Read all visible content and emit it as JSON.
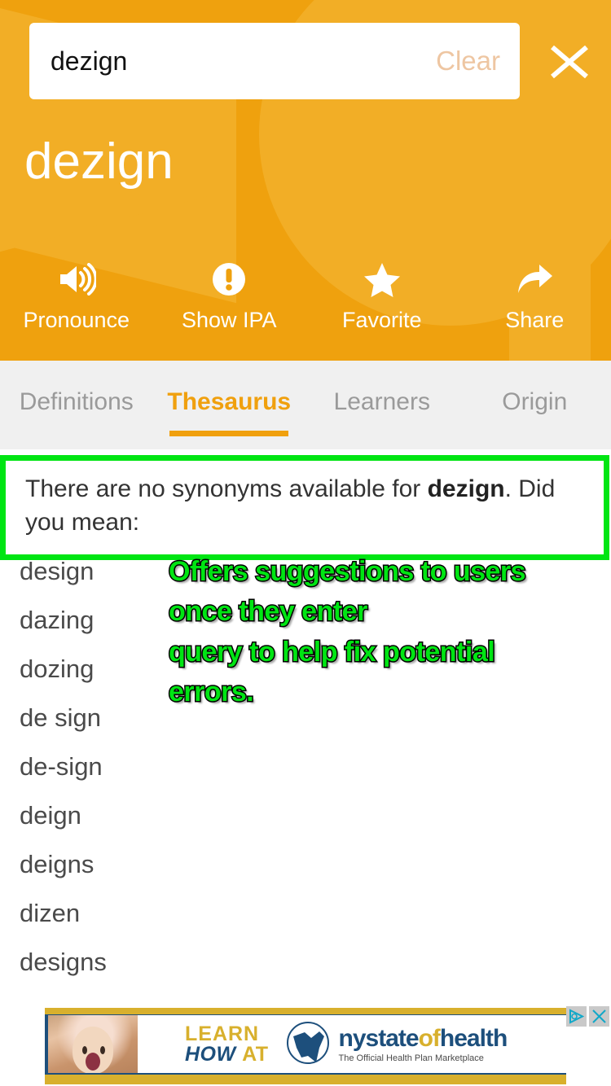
{
  "colors": {
    "header_orange": "#efa10e",
    "watermark_orange": "#f2ae26",
    "accent_orange": "#f0a00e",
    "annotation_green": "#00e513",
    "tab_bar_bg": "#f0f0f0",
    "clear_text": "#eec6a2",
    "ad_gold": "#d8b02d",
    "ad_blue": "#1d4f7c"
  },
  "search": {
    "value": "dezign",
    "placeholder": "Search the dictionary",
    "clear_label": "Clear",
    "close_icon": "close-x-icon"
  },
  "header": {
    "word": "dezign",
    "actions": [
      {
        "label": "Pronounce",
        "icon": "speaker-icon"
      },
      {
        "label": "Show IPA",
        "icon": "exclamation-circle-icon"
      },
      {
        "label": "Favorite",
        "icon": "star-icon"
      },
      {
        "label": "Share",
        "icon": "share-arrow-icon"
      }
    ]
  },
  "tabs": [
    {
      "label": "Definitions",
      "active": false
    },
    {
      "label": "Thesaurus",
      "active": true
    },
    {
      "label": "Learners",
      "active": false
    },
    {
      "label": "Origin",
      "active": false
    }
  ],
  "message": {
    "prefix": "There are no synonyms available for ",
    "word": "dezign",
    "suffix": ". Did you mean:"
  },
  "suggestions": [
    "design",
    "dazing",
    "dozing",
    "de sign",
    "de-sign",
    "deign",
    "deigns",
    "dizen",
    "designs"
  ],
  "annotation": {
    "lines": [
      "Offers suggestions to users",
      "once they enter",
      "query to help fix potential",
      "errors."
    ]
  },
  "ad": {
    "line1": "LEARN",
    "line2_italic": "HOW",
    "line2_gold": "AT",
    "brand_dark": "nystate",
    "brand_gold": "of",
    "brand_dark2": "health",
    "tagline": "The Official Health Plan Marketplace",
    "adchoices_icon": "adchoices-icon",
    "close_icon": "ad-close-icon"
  }
}
